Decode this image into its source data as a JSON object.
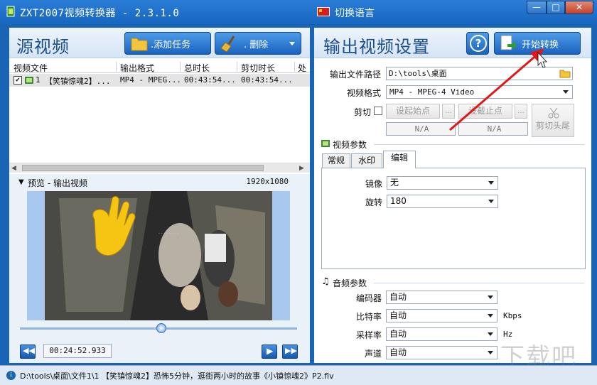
{
  "window": {
    "title": "ZXT2007视频转换器 - 2.3.1.0",
    "language_label": "切换语言",
    "minimize_glyph": "—",
    "maximize_glyph": "□",
    "close_glyph": "✕"
  },
  "source": {
    "title": "源视频",
    "add_task_label": ".添加任务",
    "delete_label": ".   删除",
    "columns": [
      "视频文件",
      "输出格式",
      "总时长",
      "剪切时长",
      "处"
    ],
    "rows": [
      {
        "index": "1",
        "name": "【笑镇惊魂2】...",
        "format": "MP4 - MPEG...",
        "total": "00:43:54...",
        "cut": "00:43:54..."
      }
    ]
  },
  "preview": {
    "label": "预览 - 输出视频",
    "resolution": "1920x1080",
    "time": "00:24:52.933",
    "progress": 0.51
  },
  "output": {
    "title": "输出视频设置",
    "help_glyph": "?",
    "start_label": "开始转换",
    "path_label": "输出文件路径",
    "path_value": "D:\\tools\\桌面",
    "format_label": "视频格式",
    "format_value": "MP4 - MPEG-4 Video",
    "cut_label": "剪切",
    "set_start_label": "设起始点",
    "set_end_label": "设截止点",
    "ellipsis": "...",
    "start_value": "N/A",
    "end_value": "N/A",
    "cut_head_tail_label": "剪切头尾"
  },
  "video_params": {
    "title": "视频参数",
    "tabs": [
      "常规",
      "水印",
      "编辑"
    ],
    "active_tab": 2,
    "mirror_label": "镜像",
    "mirror_value": "无",
    "rotate_label": "旋转",
    "rotate_value": "180"
  },
  "audio_params": {
    "title": "音频参数",
    "encoder_label": "编码器",
    "encoder_value": "自动",
    "bitrate_label": "比特率",
    "bitrate_value": "自动",
    "bitrate_unit": "Kbps",
    "samplerate_label": "采样率",
    "samplerate_value": "自动",
    "samplerate_unit": "Hz",
    "channel_label": "声道",
    "channel_value": "自动"
  },
  "statusbar": {
    "text": "D:\\tools\\桌面\\文件1\\1 【笑镇惊魂2】恐怖5分钟，逛街两小时的故事《小镇惊魂2》P2.flv"
  },
  "watermark_text": "下载吧",
  "colors": {
    "accent": "#1a64b5",
    "arrow": "#e01818",
    "highlight": "#f4c60c"
  }
}
